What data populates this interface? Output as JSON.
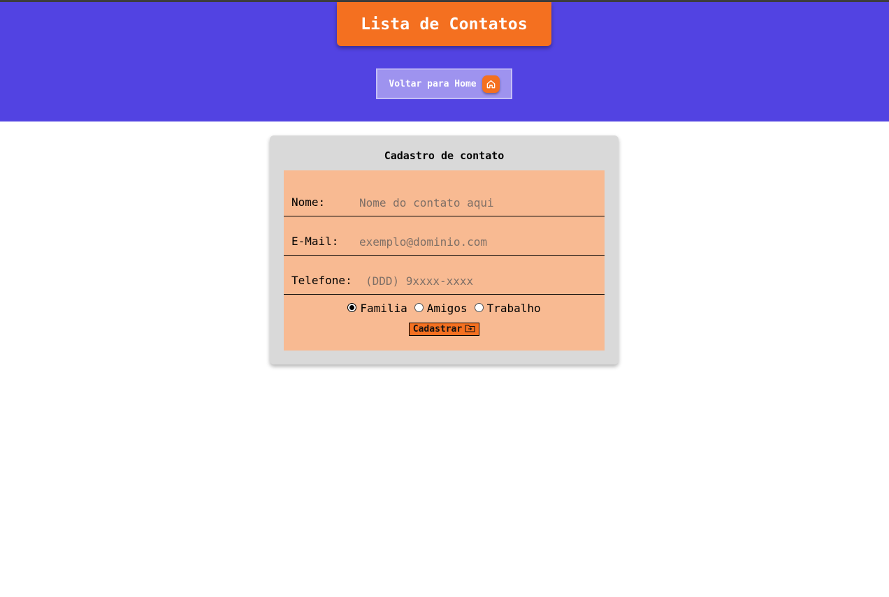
{
  "header": {
    "title": "Lista de Contatos",
    "home_link_label": "Voltar para Home",
    "home_icon": "home-icon"
  },
  "form": {
    "heading": "Cadastro de contato",
    "fields": [
      {
        "label": "Nome:",
        "placeholder": "Nome do contato aqui",
        "value": ""
      },
      {
        "label": "E-Mail:",
        "placeholder": "exemplo@dominio.com",
        "value": ""
      },
      {
        "label": "Telefone:",
        "placeholder": "(DDD) 9xxxx-xxxx",
        "value": ""
      }
    ],
    "categories": [
      {
        "label": "Familia",
        "checked": true
      },
      {
        "label": "Amigos",
        "checked": false
      },
      {
        "label": "Trabalho",
        "checked": false
      }
    ],
    "submit_label": "Cadastrar",
    "submit_icon": "add-folder-icon"
  },
  "colors": {
    "banner": "#5243e2",
    "accent": "#f47020",
    "form_bg": "#f8ba92",
    "card_bg": "#d9d9d9",
    "home_link_bg": "#9e93ef"
  }
}
